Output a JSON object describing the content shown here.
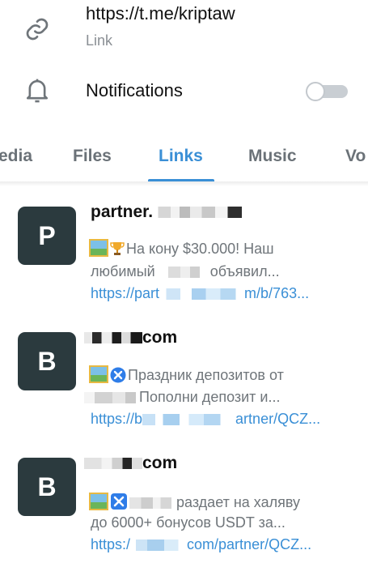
{
  "info": {
    "link_url": "https://t.me/kriptaw",
    "link_caption": "Link",
    "notifications_label": "Notifications"
  },
  "tabs": [
    "edia",
    "Files",
    "Links",
    "Music",
    "Vo"
  ],
  "items": [
    {
      "avatar_letter": "P",
      "title": "partner.",
      "line1": "На кону $30.000! Наш",
      "line2a": "любимый",
      "line2b": "объявил...",
      "url_a": "https://part",
      "url_b": "m/b/763..."
    },
    {
      "avatar_letter": "B",
      "title": "com",
      "line1": "Праздник депозитов от",
      "line2": "Пополни депозит и...",
      "url_a": "https://b",
      "url_b": "artner/QCZ..."
    },
    {
      "avatar_letter": "B",
      "title": "com",
      "line1": "раздает на халяву",
      "line2": "до 6000+ бонусов USDT за...",
      "url_a": "https:/",
      "url_b": "com/partner/QCZ..."
    }
  ]
}
